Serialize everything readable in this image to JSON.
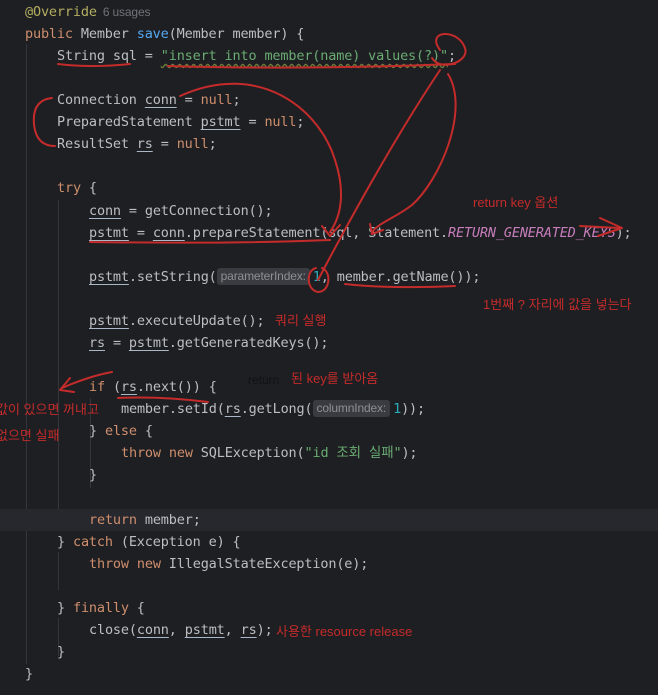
{
  "code": {
    "annotation": "@Override",
    "usages": "6 usages",
    "l1_kw": "public ",
    "l1_type": "Member ",
    "l1_fn": "save",
    "l1_rest": "(Member member) {",
    "l2_type": "String ",
    "l2_var": "sql",
    "l2_eq": " = ",
    "l2_str": "\"insert into member(name) values(?)\"",
    "l2_end": ";",
    "l3_type": "Connection ",
    "l3_var": "conn",
    "l3_eq": " = ",
    "l3_null": "null",
    "l3_end": ";",
    "l4_type": "PreparedStatement ",
    "l4_var": "pstmt",
    "l5_type": "ResultSet ",
    "l5_var": "rs",
    "try_kw": "try",
    "try_rest": " {",
    "l7_var": "conn",
    "l7_rest": " = getConnection();",
    "l8_var": "pstmt",
    "l8_eq": " = ",
    "l8_conn": "conn",
    "l8_call": ".prepareStatement(sql, Statement.",
    "l8_field": "RETURN_GENERATED_KEYS",
    "l8_end": ");",
    "l9_var": "pstmt",
    "l9_call": ".setString(",
    "l9_hint": "parameterIndex:",
    "l9_num": "1",
    "l9_rest": ", member.getName());",
    "l10_var": "pstmt",
    "l10_rest": ".executeUpdate();",
    "l11_var": "rs",
    "l11_eq": " = ",
    "l11_pstmt": "pstmt",
    "l11_rest": ".getGeneratedKeys();",
    "if_kw": "if",
    "if_open": " (",
    "if_var": "rs",
    "if_rest": ".next()) {",
    "l13_call": "member.setId(",
    "l13_var": "rs",
    "l13_mid": ".getLong(",
    "l13_hint": "columnIndex:",
    "l13_num": "1",
    "l13_end": "));",
    "else_open": "} ",
    "else_kw": "else",
    "else_rest": " {",
    "throw_kw": "throw",
    "new_kw": " new ",
    "sqlex": "SQLException(",
    "sqlex_str": "\"id 조회 실패\"",
    "sqlex_end": ");",
    "close_brace": "}",
    "return_kw": "return",
    "return_rest": " member;",
    "catch_open": "} ",
    "catch_kw": "catch",
    "catch_rest": " (Exception e) {",
    "ise": "IllegalStateException(e);",
    "finally_kw": "finally",
    "close_call": "close(",
    "close_conn": "conn",
    "close_sep": ", ",
    "close_pstmt": "pstmt",
    "close_rs": "rs",
    "close_end": ");"
  },
  "notes": {
    "return_key_option": "return key 옵션",
    "first_slot": "1번째 ? 자리에 값을 넣는다",
    "query_run": "쿼리 실행",
    "return_word": "return",
    "key_received": "된 key를 받아옴",
    "left_note_1": "값이 있으면 꺼내고",
    "left_note_2": "없으면 실패",
    "resource_release": "사용한 resource release"
  },
  "colors": {
    "background": "#1e1f22",
    "keyword": "#cf8e6d",
    "function": "#56a8f5",
    "string": "#6aab73",
    "annotation": "#b3ae60",
    "number": "#2aacb8",
    "static_field": "#c77dbb",
    "scribble": "#c42b2b"
  }
}
